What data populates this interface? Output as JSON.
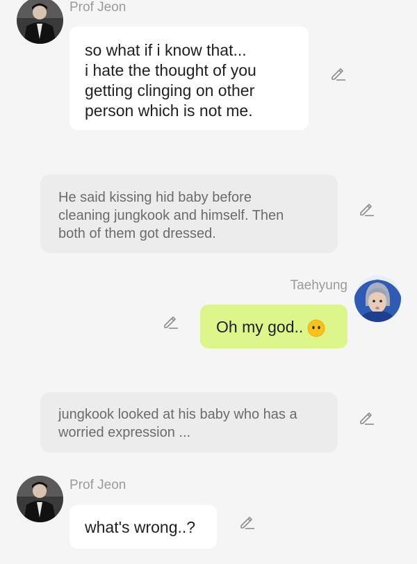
{
  "messages": [
    {
      "sender": "Prof Jeon",
      "lines": [
        "so what if i know that...",
        "i hate the thought of you",
        "getting clinging on other",
        "person which is not me."
      ]
    },
    {
      "narration_lines": [
        "He said kissing hid baby before",
        "cleaning jungkook and himself. Then",
        "both of them got dressed."
      ]
    },
    {
      "sender": "Taehyung",
      "text": "Oh my god..",
      "emoji": "neutral-face-emoji"
    },
    {
      "narration_lines": [
        "jungkook looked at his baby who has a",
        "worried expression ..."
      ]
    },
    {
      "sender": "Prof Jeon",
      "text": "what's wrong..?"
    }
  ],
  "icons": {
    "edit": "pencil-icon",
    "avatar_prof_jeon": "avatar-photo-dark",
    "avatar_taehyung": "avatar-photo-blue-hood"
  },
  "colors": {
    "background": "#f5f5f5",
    "bubble_incoming": "#ffffff",
    "bubble_outgoing": "#dcf68c",
    "narration": "#ececec",
    "sender_name": "#9a9a9a"
  }
}
